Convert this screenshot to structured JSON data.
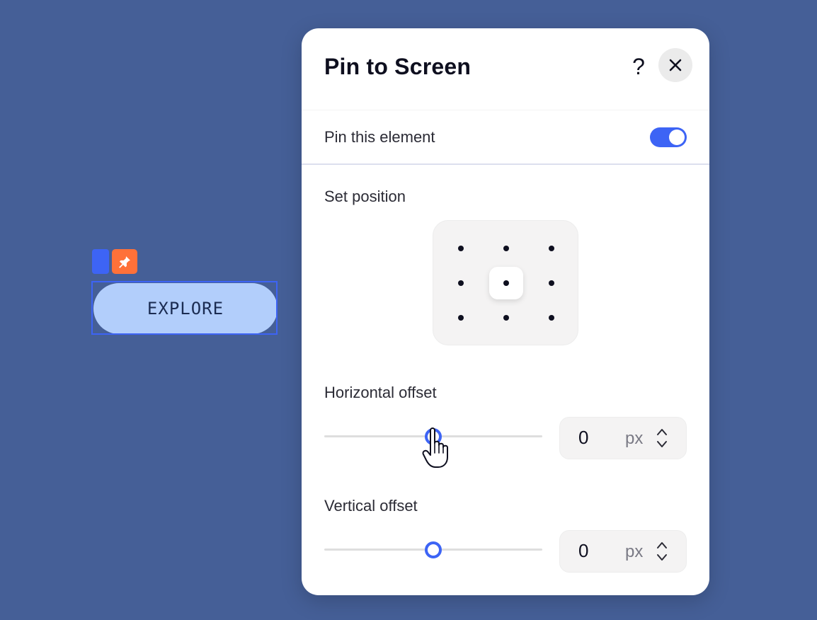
{
  "canvas": {
    "button_label": "EXPLORE"
  },
  "panel": {
    "title": "Pin to Screen",
    "help_label": "?",
    "pin_row": {
      "label": "Pin this element",
      "enabled": true
    },
    "position": {
      "label": "Set position",
      "selected": "center"
    },
    "horizontal": {
      "label": "Horizontal offset",
      "value": "0",
      "unit": "px",
      "slider_fraction": 0.5
    },
    "vertical": {
      "label": "Vertical offset",
      "value": "0",
      "unit": "px",
      "slider_fraction": 0.5
    }
  },
  "colors": {
    "background": "#455f97",
    "accent": "#3d64f5",
    "pin_tag": "#ff7139",
    "explore_fill": "#b2cefb"
  }
}
